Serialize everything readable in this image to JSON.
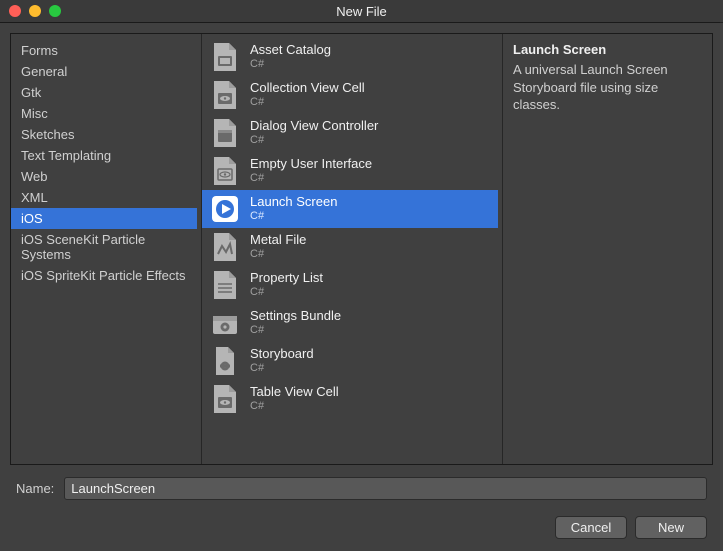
{
  "window": {
    "title": "New File"
  },
  "sidebar": {
    "items": [
      {
        "label": "Forms",
        "selected": false
      },
      {
        "label": "General",
        "selected": false
      },
      {
        "label": "Gtk",
        "selected": false
      },
      {
        "label": "Misc",
        "selected": false
      },
      {
        "label": "Sketches",
        "selected": false
      },
      {
        "label": "Text Templating",
        "selected": false
      },
      {
        "label": "Web",
        "selected": false
      },
      {
        "label": "XML",
        "selected": false
      },
      {
        "label": "iOS",
        "selected": true
      },
      {
        "label": "iOS SceneKit Particle Systems",
        "selected": false
      },
      {
        "label": "iOS SpriteKit Particle Effects",
        "selected": false
      }
    ]
  },
  "templates": {
    "items": [
      {
        "name": "Asset Catalog",
        "lang": "C#",
        "icon": "asset-catalog-icon",
        "selected": false
      },
      {
        "name": "Collection View Cell",
        "lang": "C#",
        "icon": "view-cell-icon",
        "selected": false
      },
      {
        "name": "Dialog View Controller",
        "lang": "C#",
        "icon": "dialog-icon",
        "selected": false
      },
      {
        "name": "Empty User Interface",
        "lang": "C#",
        "icon": "empty-ui-icon",
        "selected": false
      },
      {
        "name": "Launch Screen",
        "lang": "C#",
        "icon": "launch-screen-icon",
        "selected": true
      },
      {
        "name": "Metal File",
        "lang": "C#",
        "icon": "metal-icon",
        "selected": false
      },
      {
        "name": "Property List",
        "lang": "C#",
        "icon": "plist-icon",
        "selected": false
      },
      {
        "name": "Settings Bundle",
        "lang": "C#",
        "icon": "settings-bundle-icon",
        "selected": false
      },
      {
        "name": "Storyboard",
        "lang": "C#",
        "icon": "storyboard-icon",
        "selected": false
      },
      {
        "name": "Table View Cell",
        "lang": "C#",
        "icon": "table-cell-icon",
        "selected": false
      }
    ]
  },
  "description": {
    "title": "Launch Screen",
    "text": "A universal Launch Screen Storyboard file using size classes."
  },
  "name_field": {
    "label": "Name:",
    "value": "LaunchScreen"
  },
  "footer": {
    "cancel_label": "Cancel",
    "new_label": "New"
  },
  "colors": {
    "accent": "#3573d8"
  }
}
